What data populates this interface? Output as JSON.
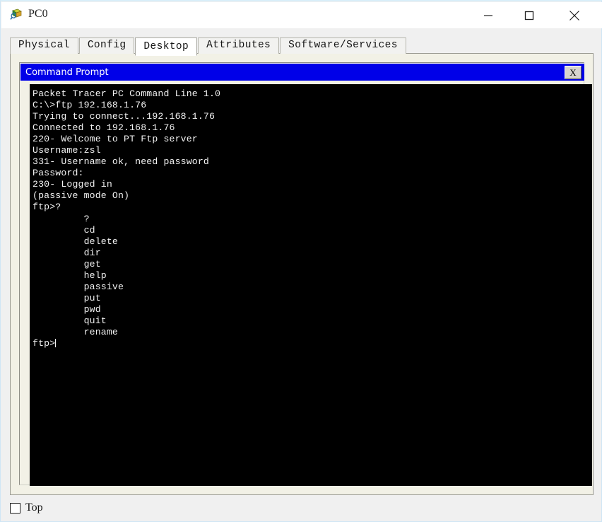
{
  "window": {
    "title": "PC0",
    "icon": "packet-tracer-device-icon",
    "controls": {
      "minimize": "minimize-icon",
      "maximize": "maximize-icon",
      "close": "close-icon"
    }
  },
  "tabs": [
    {
      "label": "Physical",
      "active": false
    },
    {
      "label": "Config",
      "active": false
    },
    {
      "label": "Desktop",
      "active": true
    },
    {
      "label": "Attributes",
      "active": false
    },
    {
      "label": "Software/Services",
      "active": false
    }
  ],
  "command_prompt": {
    "title": "Command Prompt",
    "close_label": "X",
    "title_bar_color": "#0000e8",
    "terminal_background": "#000000",
    "terminal_text_color": "#f2f2f2",
    "lines": [
      "Packet Tracer PC Command Line 1.0",
      "C:\\>ftp 192.168.1.76",
      "Trying to connect...192.168.1.76",
      "Connected to 192.168.1.76",
      "220- Welcome to PT Ftp server",
      "Username:zsl",
      "331- Username ok, need password",
      "Password:",
      "230- Logged in",
      "(passive mode On)",
      "ftp>?",
      "         ?",
      "         cd",
      "         delete",
      "         dir",
      "         get",
      "         help",
      "         passive",
      "         put",
      "         pwd",
      "         quit",
      "         rename",
      "ftp>"
    ],
    "prompt_text": "ftp>",
    "ftp_commands": [
      "?",
      "cd",
      "delete",
      "dir",
      "get",
      "help",
      "passive",
      "put",
      "pwd",
      "quit",
      "rename"
    ],
    "server_address": "192.168.1.76",
    "username": "zsl"
  },
  "footer": {
    "top_checkbox_label": "Top",
    "top_checkbox_checked": false
  }
}
